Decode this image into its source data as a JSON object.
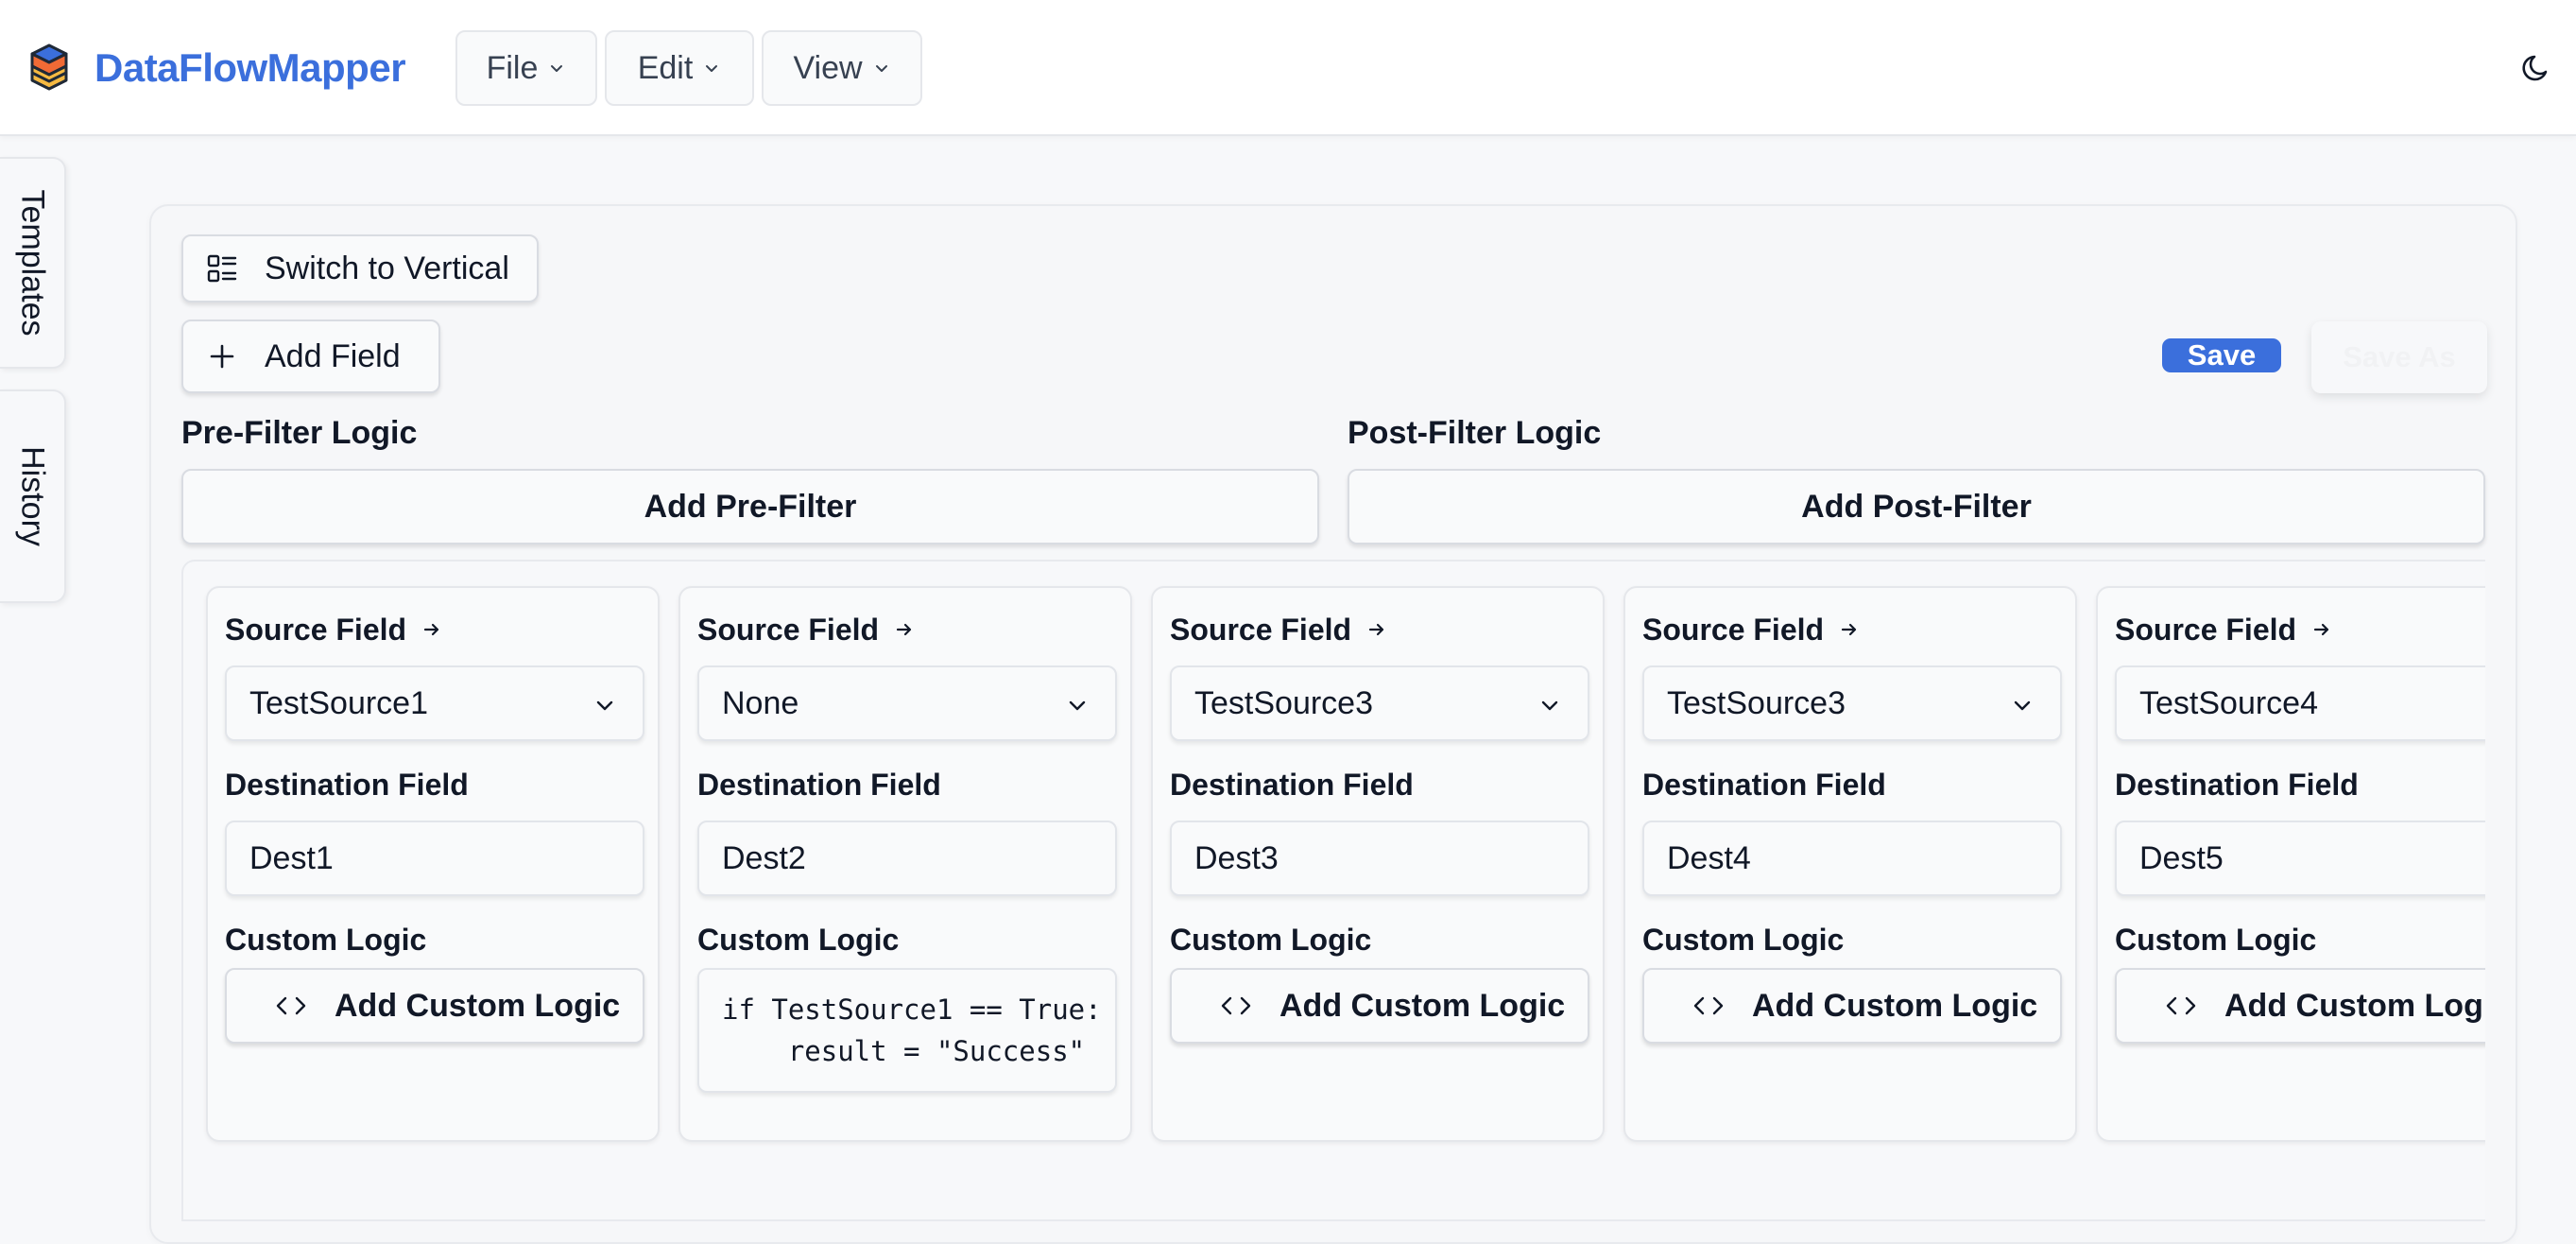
{
  "app": {
    "title": "DataFlowMapper",
    "menus": [
      {
        "label": "File"
      },
      {
        "label": "Edit"
      },
      {
        "label": "View"
      }
    ]
  },
  "side_tabs": {
    "templates": "Templates",
    "history": "History"
  },
  "toolbar": {
    "switch_label": "Switch to Vertical",
    "add_field_label": "Add Field",
    "save_label": "Save",
    "save_as_label": "Save As"
  },
  "filters": {
    "pre_label": "Pre-Filter Logic",
    "pre_button": "Add Pre-Filter",
    "post_label": "Post-Filter Logic",
    "post_button": "Add Post-Filter"
  },
  "labels": {
    "source": "Source Field",
    "destination": "Destination Field",
    "custom_logic": "Custom Logic",
    "add_custom_logic": "Add Custom Logic"
  },
  "mappings": [
    {
      "source": "TestSource1",
      "destination": "Dest1",
      "logic": null
    },
    {
      "source": "None",
      "destination": "Dest2",
      "logic": [
        "if TestSource1 == True:",
        "    result = \"Success\""
      ]
    },
    {
      "source": "TestSource3",
      "destination": "Dest3",
      "logic": null
    },
    {
      "source": "TestSource3",
      "destination": "Dest4",
      "logic": null
    },
    {
      "source": "TestSource4",
      "destination": "Dest5",
      "logic": null
    }
  ],
  "colors": {
    "brand": "#3b6fdc",
    "save_button": "#3b6fdc",
    "background": "#f7f8fa"
  },
  "icons": {
    "logo": "stacked-layers-logo-icon",
    "theme_toggle": "moon-icon",
    "switch": "layout-list-icon",
    "add": "plus-icon",
    "custom_logic": "code-icon",
    "source_arrow": "arrow-right-icon",
    "dropdown": "chevron-down-icon"
  }
}
